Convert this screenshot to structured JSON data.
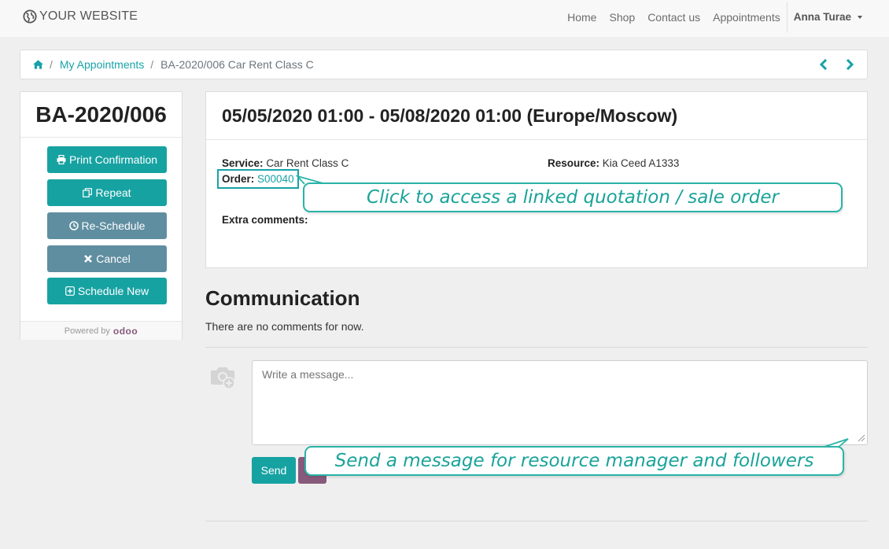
{
  "navbar": {
    "brand": "YOUR WEBSITE",
    "links": [
      "Home",
      "Shop",
      "Contact us",
      "Appointments"
    ],
    "user": "Anna Turae"
  },
  "breadcrumb": {
    "link": "My Appointments",
    "current": "BA-2020/006 Car Rent Class C"
  },
  "sidebar": {
    "title": "BA-2020/006",
    "buttons": [
      "Print Confirmation",
      "Repeat",
      "Re-Schedule",
      "Cancel",
      "Schedule New"
    ],
    "powered_by": "Powered by",
    "odoo": "odoo"
  },
  "appointment": {
    "title": "05/05/2020 01:00 - 05/08/2020 01:00 (Europe/Moscow)",
    "service_label": "Service:",
    "service_value": "Car Rent Class C",
    "resource_label": "Resource:",
    "resource_value": "Kia Ceed A1333",
    "order_label": "Order:",
    "order_value": "S00040",
    "extra_label": "Extra comments:"
  },
  "communication": {
    "title": "Communication",
    "empty_text": "There are no comments for now.",
    "placeholder": "Write a message...",
    "send_label": "Send"
  },
  "callouts": {
    "order": "Click to access a linked quotation / sale order",
    "message": "Send a message for resource manager and followers"
  },
  "colors": {
    "accent": "#17a2a2",
    "slate": "#5f8ea0",
    "odoo_purple": "#875a7b",
    "callout": "#2ab3a7"
  }
}
